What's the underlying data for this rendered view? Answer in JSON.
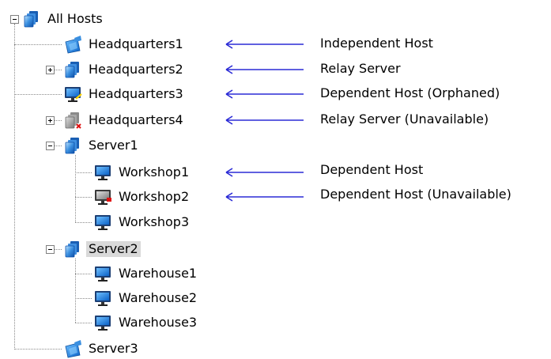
{
  "colors": {
    "arrow": "#2b2bd6",
    "selection": "#d9d9d9",
    "connector": "#8a8a8a"
  },
  "tree": {
    "root": {
      "label": "All Hosts",
      "icon": "all-hosts-icon",
      "expanded": true
    },
    "nodes": [
      {
        "label": "Headquarters1",
        "icon": "independent-host-icon",
        "expander": "none"
      },
      {
        "label": "Headquarters2",
        "icon": "relay-server-icon",
        "expander": "plus"
      },
      {
        "label": "Headquarters3",
        "icon": "dependent-host-orphaned-icon",
        "expander": "none"
      },
      {
        "label": "Headquarters4",
        "icon": "relay-server-unavailable-icon",
        "expander": "plus"
      },
      {
        "label": "Server1",
        "icon": "relay-server-icon",
        "expander": "minus",
        "children": [
          {
            "label": "Workshop1",
            "icon": "dependent-host-icon"
          },
          {
            "label": "Workshop2",
            "icon": "dependent-host-unavailable-icon"
          },
          {
            "label": "Workshop3",
            "icon": "dependent-host-icon"
          }
        ]
      },
      {
        "label": "Server2",
        "icon": "relay-server-icon",
        "expander": "minus",
        "selected": true,
        "children": [
          {
            "label": "Warehouse1",
            "icon": "dependent-host-icon"
          },
          {
            "label": "Warehouse2",
            "icon": "dependent-host-icon"
          },
          {
            "label": "Warehouse3",
            "icon": "dependent-host-icon"
          }
        ]
      },
      {
        "label": "Server3",
        "icon": "independent-host-icon",
        "expander": "none"
      }
    ]
  },
  "annotations": [
    {
      "target": "Headquarters1",
      "text": "Independent Host"
    },
    {
      "target": "Headquarters2",
      "text": "Relay Server"
    },
    {
      "target": "Headquarters3",
      "text": "Dependent Host (Orphaned)"
    },
    {
      "target": "Headquarters4",
      "text": "Relay Server (Unavailable)"
    },
    {
      "target": "Workshop1",
      "text": "Dependent Host"
    },
    {
      "target": "Workshop2",
      "text": "Dependent Host (Unavailable)"
    }
  ]
}
